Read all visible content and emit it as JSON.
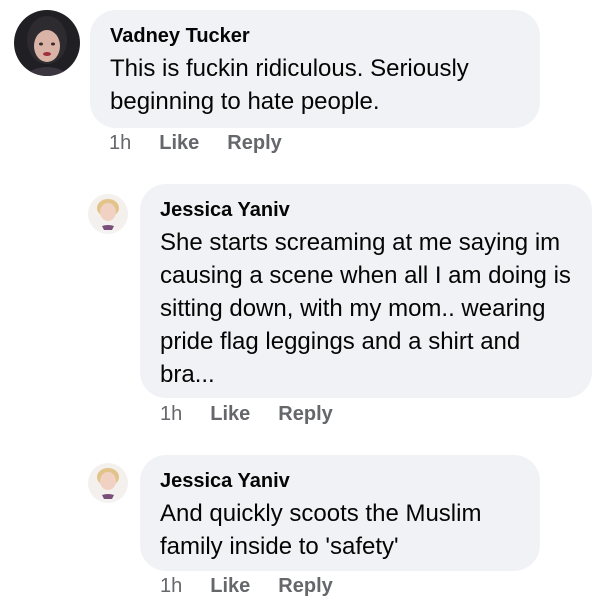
{
  "comments": [
    {
      "author": "Vadney Tucker",
      "text": "This is fuckin ridiculous.  Seriously beginning to hate people.",
      "time": "1h",
      "like_label": "Like",
      "reply_label": "Reply"
    },
    {
      "author": "Jessica Yaniv",
      "text": "She starts screaming at me saying im causing a scene when all I am doing is sitting down, with my mom.. wearing pride flag leggings and a shirt and bra...",
      "time": "1h",
      "like_label": "Like",
      "reply_label": "Reply"
    },
    {
      "author": "Jessica Yaniv",
      "text": "And quickly scoots the Muslim family inside to 'safety'",
      "time": "1h",
      "like_label": "Like",
      "reply_label": "Reply"
    }
  ],
  "colors": {
    "bubble": "#f0f2f5",
    "meta_text": "#65676b",
    "text": "#050505"
  }
}
